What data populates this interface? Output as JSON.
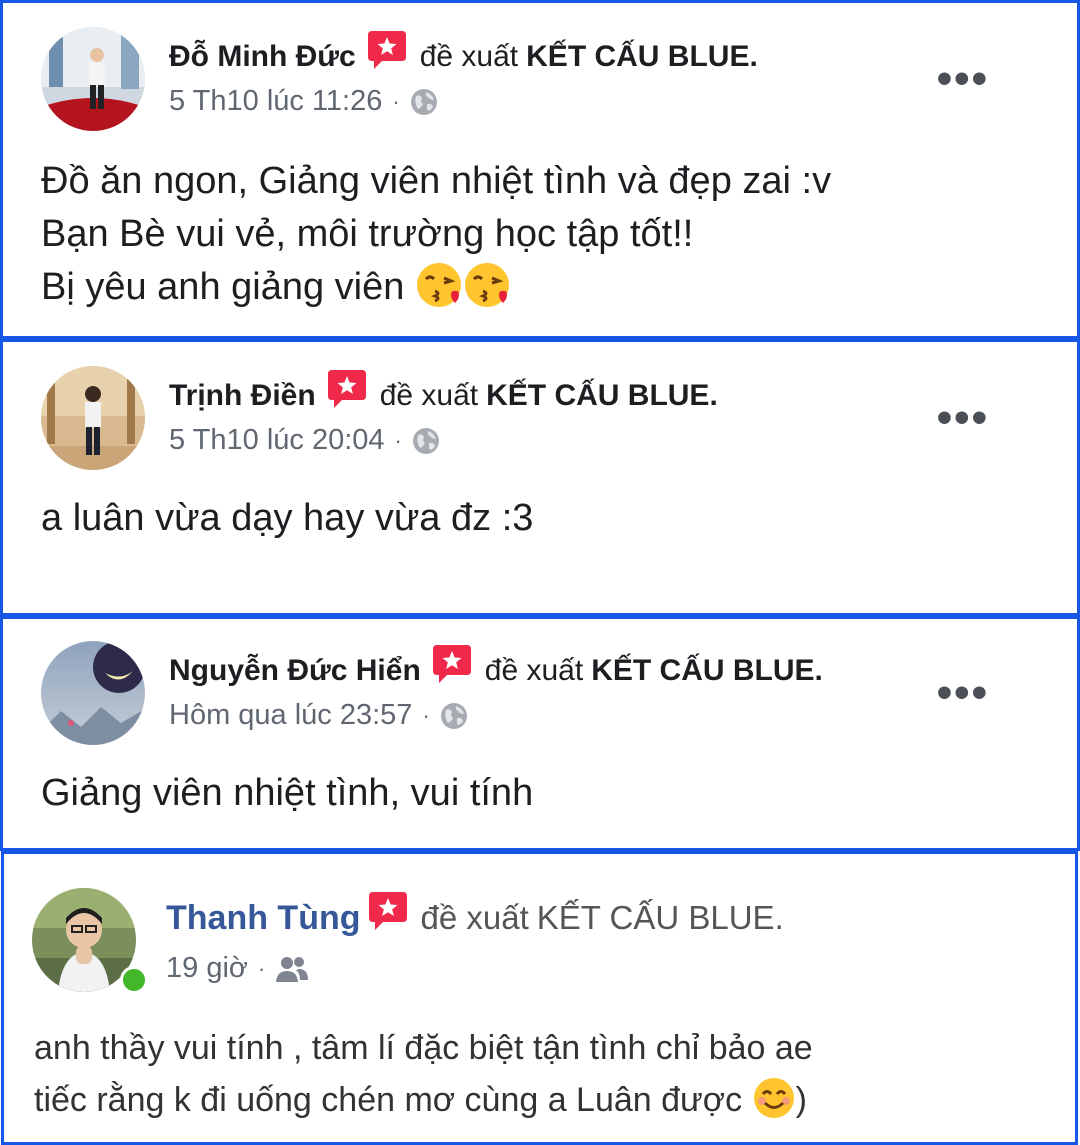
{
  "posts": [
    {
      "author": "Đỗ Minh Đức",
      "verb": "đề xuất",
      "page": "KẾT CẤU BLUE.",
      "time": "5 Th10 lúc 11:26",
      "separator": "·",
      "audience_icon": "globe-icon",
      "more": "•••",
      "lines": [
        "Đồ ăn ngon, Giảng viên nhiệt tình và đẹp zai :v",
        "Bạn Bè vui vẻ, môi trường học tập tốt!!",
        "Bị yêu anh giảng viên"
      ]
    },
    {
      "author": "Trịnh Điền",
      "verb": "đề xuất",
      "page": "KẾT CẤU BLUE.",
      "time": "5 Th10 lúc 20:04",
      "separator": "·",
      "audience_icon": "globe-icon",
      "more": "•••",
      "lines": [
        "a luân vừa dạy hay vừa đz :3"
      ]
    },
    {
      "author": "Nguyễn Đức Hiển",
      "verb": "đề xuất",
      "page": "KẾT CẤU BLUE.",
      "time": "Hôm qua lúc 23:57",
      "separator": "·",
      "audience_icon": "globe-icon",
      "more": "•••",
      "lines": [
        "Giảng viên nhiệt tình, vui tính"
      ]
    },
    {
      "author": "Thanh Tùng",
      "verb": "đề xuất",
      "page": "KẾT CẤU BLUE.",
      "time": "19 giờ",
      "separator": "·",
      "audience_icon": "friends-icon",
      "lines": [
        "anh thầy vui tính , tâm lí đặc biệt tận tình chỉ bảo ae",
        "tiếc rằng k đi uống chén mơ cùng a Luân được",
        ")"
      ]
    }
  ],
  "colors": {
    "border": "#1656e8",
    "recommend_icon": "#f0284a",
    "link_blue": "#365899",
    "online": "#42b72a"
  }
}
